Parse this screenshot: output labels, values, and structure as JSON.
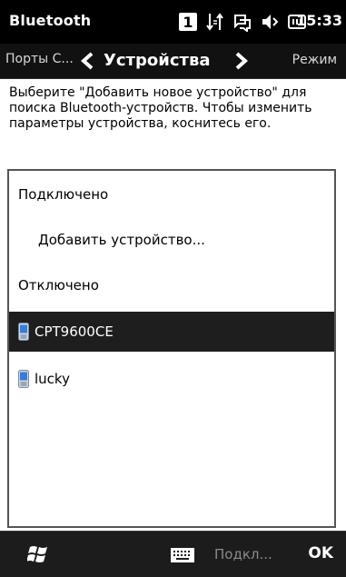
{
  "statusbar": {
    "title": "Bluetooth",
    "notification_count": "1",
    "time": "15:33",
    "icons": [
      "notification-count-icon",
      "data-connection-icon",
      "network-icon",
      "volume-icon",
      "battery-icon"
    ]
  },
  "tabs": {
    "left": "Порты С...",
    "current": "Устройства",
    "right": "Режим"
  },
  "instructions": "Выберите \"Добавить новое устройство\" для поиска Bluetooth-устройств. Чтобы изменить параметры устройства, коснитесь его.",
  "device_list": {
    "connected_header": "Подключено",
    "add_device": "Добавить устройство...",
    "disconnected_header": "Отключено",
    "devices": [
      {
        "name": "CPT9600CE",
        "selected": true,
        "icon": "phone-icon"
      },
      {
        "name": "lucky",
        "selected": false,
        "icon": "phone-icon"
      }
    ]
  },
  "softkeys": {
    "left": "Подкл...",
    "right": "OK"
  },
  "colors": {
    "statusbar_bg": "#000000",
    "tabbar_bg": "#111111",
    "selected_row_bg": "#1e1e1e",
    "softkey_bg": "#1c1c1c",
    "phone_icon_blue": "#3a7bd5"
  }
}
